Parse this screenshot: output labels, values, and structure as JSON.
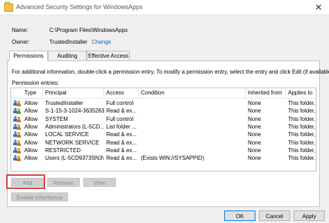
{
  "window": {
    "title": "Advanced Security Settings for WindowsApps"
  },
  "name_row": {
    "label": "Name:",
    "value": "C:\\Program Files\\WindowsApps"
  },
  "owner_row": {
    "label": "Owner:",
    "value": "TrustedInstaller",
    "change_link": "Change"
  },
  "tabs": [
    {
      "label": "Permissions",
      "active": true
    },
    {
      "label": "Auditing",
      "active": false
    },
    {
      "label": "Effective Access",
      "active": false
    }
  ],
  "permissions": {
    "info": "For additional information, double-click a permission entry. To modify a permission entry, select the entry and click Edit (if available).",
    "entries_label": "Permission entries:",
    "columns": [
      "Type",
      "Principal",
      "Access",
      "Condition",
      "Inherited from",
      "Applies to"
    ],
    "rows": [
      {
        "type": "Allow",
        "principal": "TrustedInstaller",
        "access": "Full control",
        "condition": "",
        "inherited": "None",
        "applies": "This folder, ...",
        "icon": "users-icon"
      },
      {
        "type": "Allow",
        "principal": "S-1-15-3-1024-3635283...",
        "access": "Read & ex...",
        "condition": "",
        "inherited": "None",
        "applies": "This folder, ...",
        "icon": "unknown-sid-icon"
      },
      {
        "type": "Allow",
        "principal": "SYSTEM",
        "access": "Full control",
        "condition": "",
        "inherited": "None",
        "applies": "This folder, ...",
        "icon": "users-icon"
      },
      {
        "type": "Allow",
        "principal": "Administrators (L-5CD...",
        "access": "List folder ...",
        "condition": "",
        "inherited": "None",
        "applies": "This folder, ...",
        "icon": "users-icon"
      },
      {
        "type": "Allow",
        "principal": "LOCAL SERVICE",
        "access": "Read & ex...",
        "condition": "",
        "inherited": "None",
        "applies": "This folder, ...",
        "icon": "users-icon"
      },
      {
        "type": "Allow",
        "principal": "NETWORK SERVICE",
        "access": "Read & ex...",
        "condition": "",
        "inherited": "None",
        "applies": "This folder, ...",
        "icon": "users-icon"
      },
      {
        "type": "Allow",
        "principal": "RESTRICTED",
        "access": "Read & ex...",
        "condition": "",
        "inherited": "None",
        "applies": "This folder, ...",
        "icon": "users-icon"
      },
      {
        "type": "Allow",
        "principal": "Users (L-5CD9373SN3\\...",
        "access": "Read & ex...",
        "condition": "(Exists WIN://SYSAPPID)",
        "inherited": "None",
        "applies": "This folder, ...",
        "icon": "users-icon"
      }
    ]
  },
  "buttons": {
    "add": "Add",
    "remove": "Remove",
    "view": "View",
    "enable_inheritance": "Enable inheritance",
    "ok": "OK",
    "cancel": "Cancel",
    "apply": "Apply"
  },
  "colors": {
    "link": "#1a5fb4",
    "highlight": "#d83b3b",
    "default_border": "#0078d7"
  }
}
